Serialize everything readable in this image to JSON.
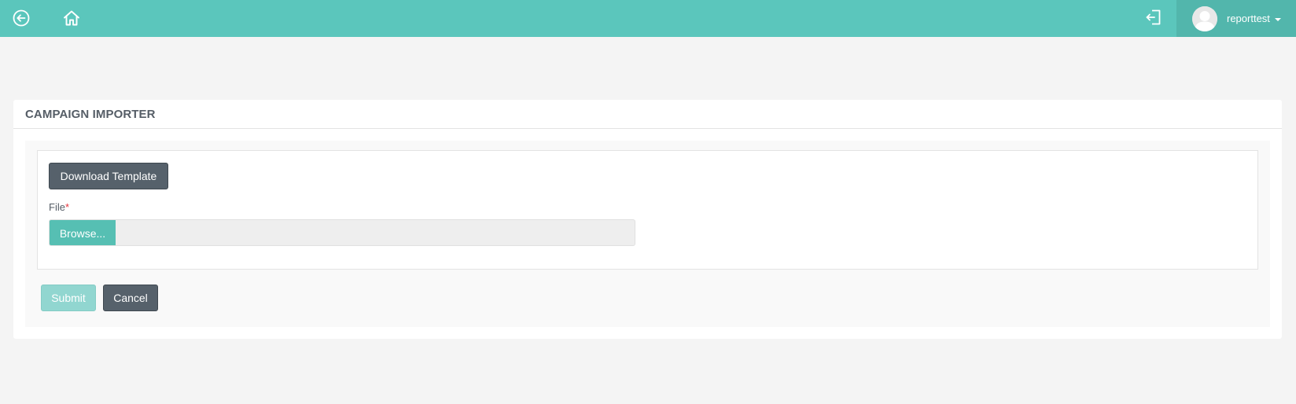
{
  "topbar": {
    "back_icon": "arrow-left-circle-icon",
    "home_icon": "home-icon",
    "logout_icon": "logout-icon",
    "user": {
      "name": "reporttest",
      "avatar_icon": "user-avatar-icon"
    },
    "color": "#5bc6bc"
  },
  "card": {
    "title": "CAMPAIGN IMPORTER",
    "download_label": "Download Template",
    "file_label": "File",
    "required_mark": "*",
    "browse_label": "Browse...",
    "file_value": "",
    "submit_label": "Submit",
    "cancel_label": "Cancel"
  },
  "colors": {
    "accent": "#5bc6bc",
    "dark_button": "#56616b",
    "required": "#e5343d"
  }
}
